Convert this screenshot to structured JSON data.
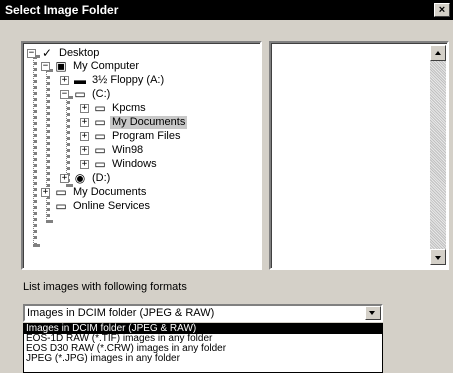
{
  "window": {
    "title": "Select Image Folder",
    "close_label": "×"
  },
  "tree": {
    "items": [
      {
        "label": "Desktop",
        "icon": "desktop-icon",
        "glyph": "✓",
        "toggle": "−"
      },
      {
        "label": "My Computer",
        "icon": "computer-icon",
        "glyph": "▣",
        "toggle": "−"
      },
      {
        "label": "3½ Floppy (A:)",
        "icon": "floppy-icon",
        "glyph": "▬",
        "toggle": "+"
      },
      {
        "label": "(C:)",
        "icon": "harddrive-icon",
        "glyph": "▭",
        "toggle": "−"
      },
      {
        "label": "Kpcms",
        "icon": "folder-icon",
        "glyph": "▭",
        "toggle": "+"
      },
      {
        "label": "My Documents",
        "icon": "folder-icon",
        "glyph": "▭",
        "toggle": "+"
      },
      {
        "label": "Program Files",
        "icon": "folder-icon",
        "glyph": "▭",
        "toggle": "+"
      },
      {
        "label": "Win98",
        "icon": "folder-icon",
        "glyph": "▭",
        "toggle": "+"
      },
      {
        "label": "Windows",
        "icon": "folder-icon",
        "glyph": "▭",
        "toggle": "+"
      },
      {
        "label": "(D:)",
        "icon": "cdrom-icon",
        "glyph": "◉",
        "toggle": "+"
      },
      {
        "label": "My Documents",
        "icon": "folder-icon",
        "glyph": "▭",
        "toggle": "+"
      },
      {
        "label": "Online Services",
        "icon": "folder-icon",
        "glyph": "▭",
        "toggle": ""
      }
    ],
    "selected": "My Documents"
  },
  "formats": {
    "label": "List images with following formats",
    "selected": "Images in DCIM folder (JPEG & RAW)",
    "options": [
      "Images in DCIM folder (JPEG & RAW)",
      "EOS-1D RAW (*.TIF) images in any folder",
      "EOS D30 RAW (*.CRW) images in any folder",
      "JPEG (*.JPG) images in any folder"
    ]
  }
}
